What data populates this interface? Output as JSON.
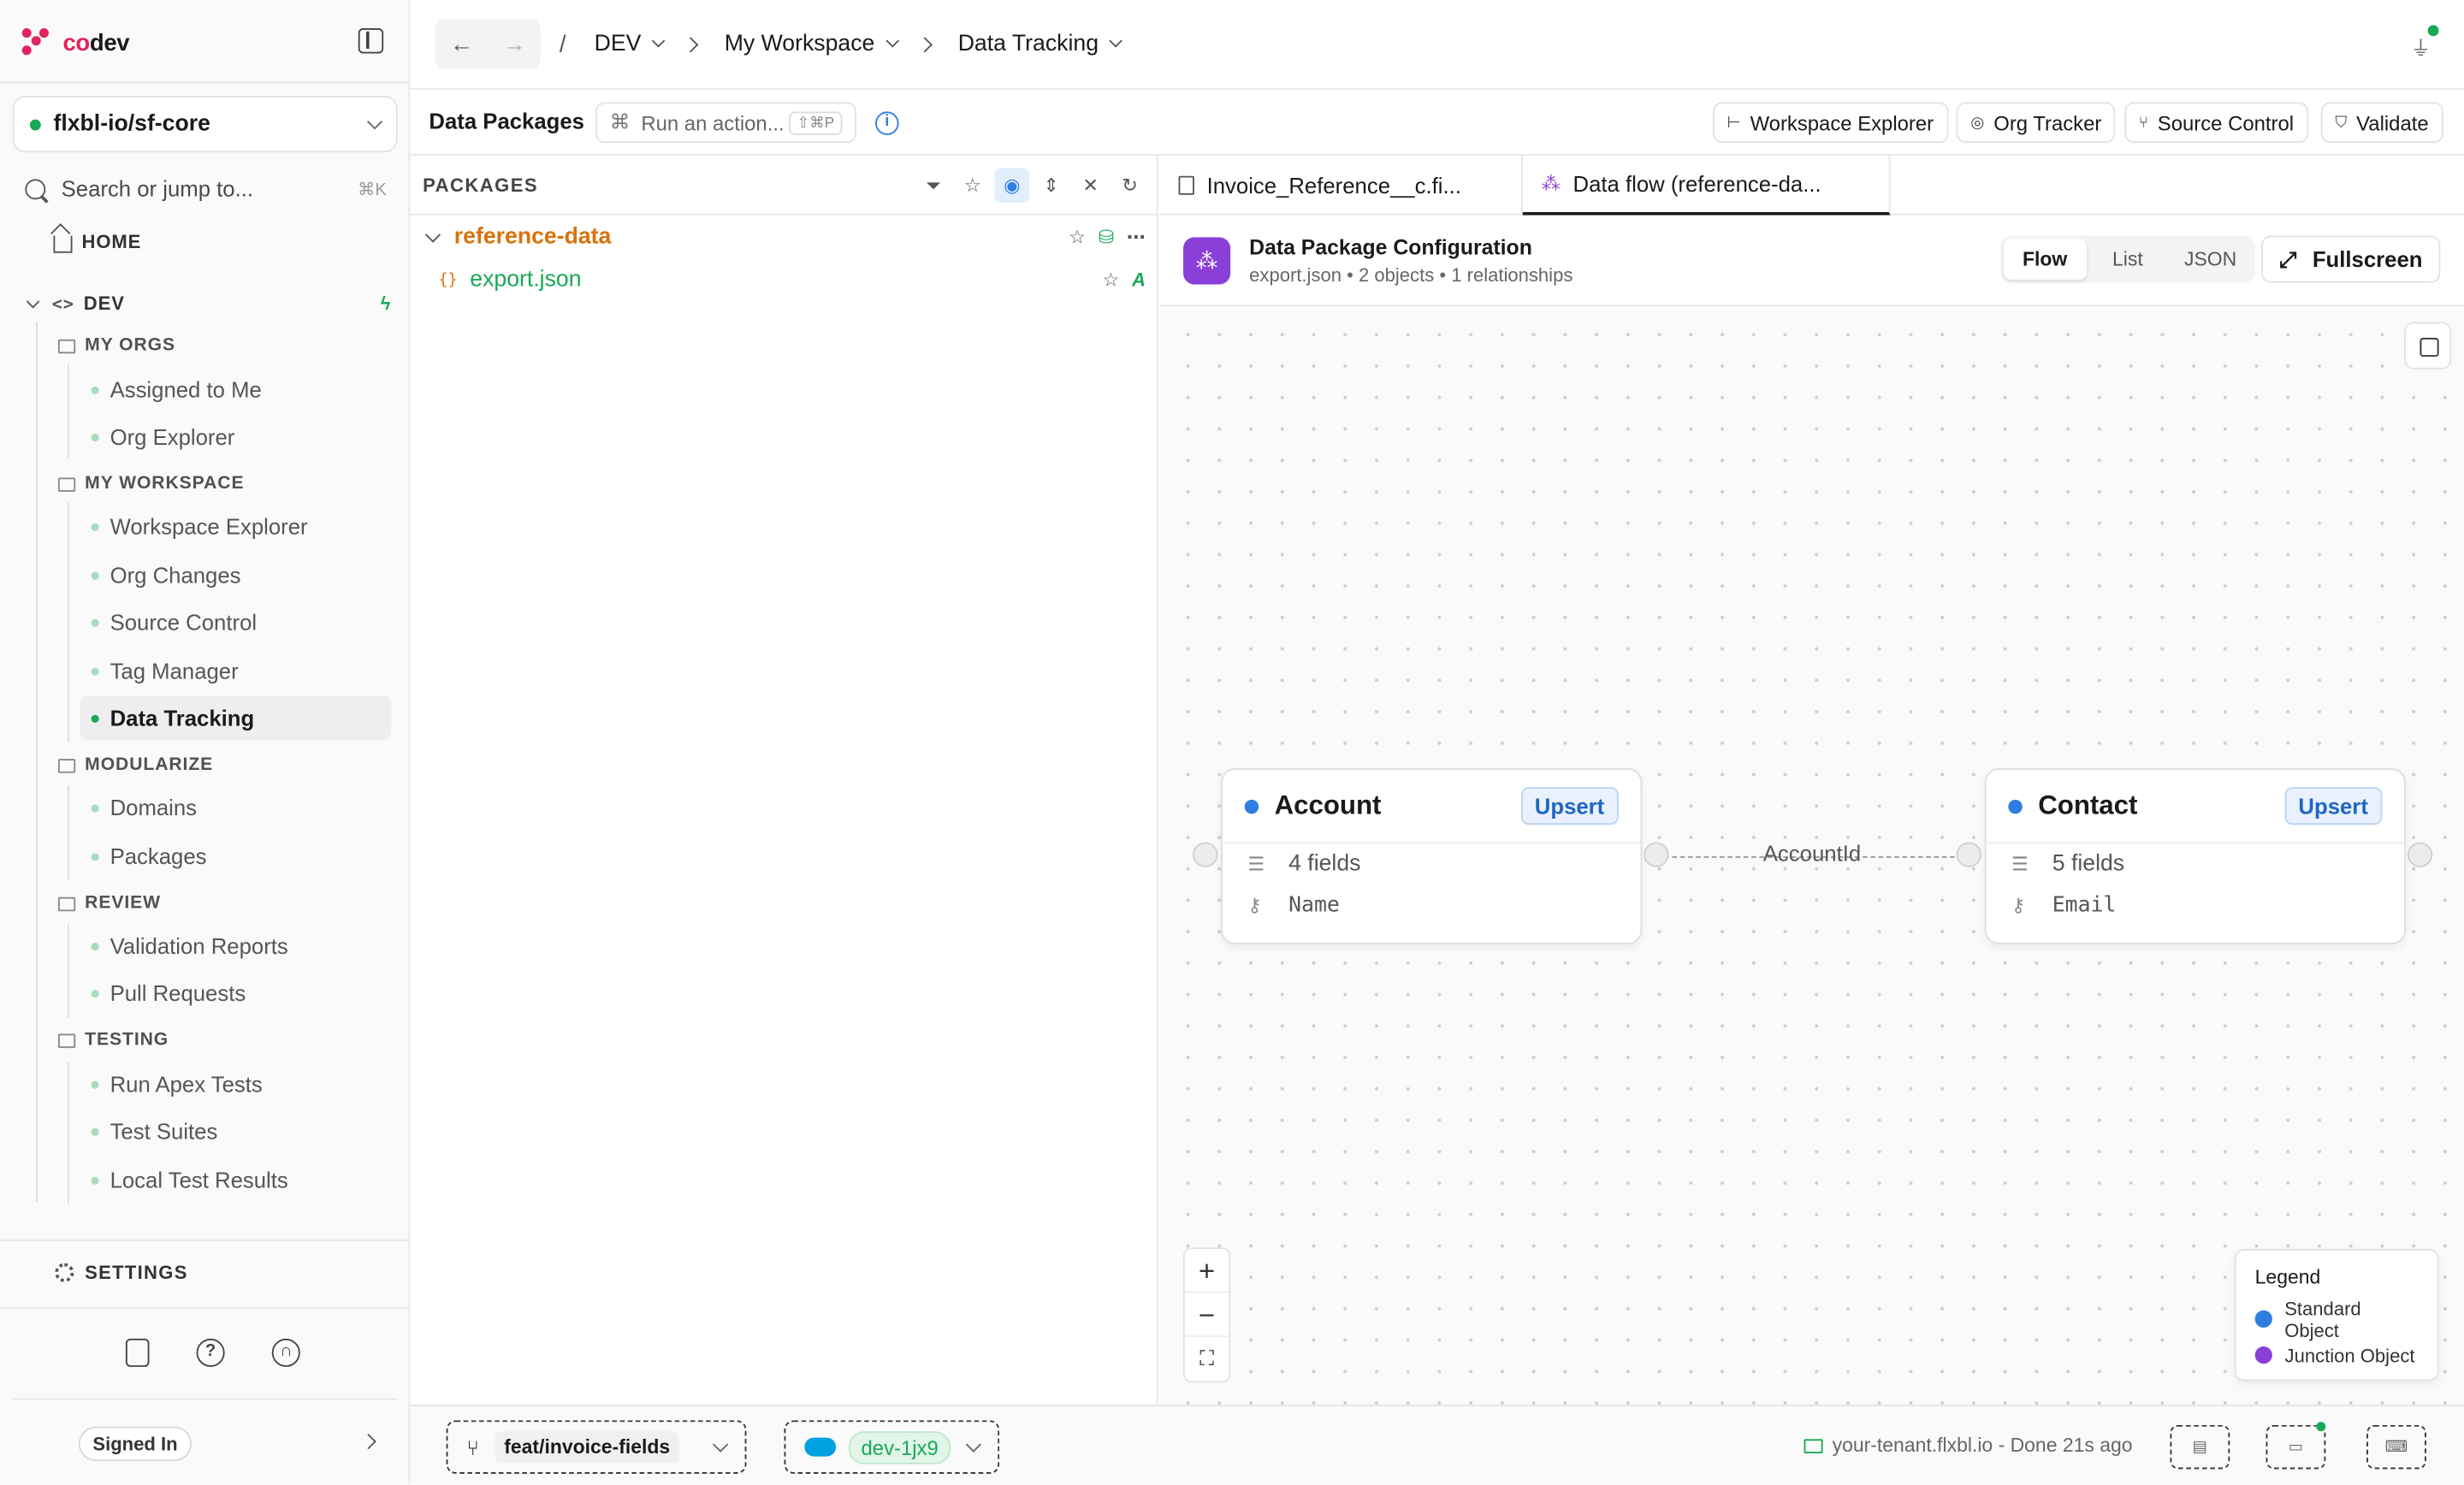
{
  "brand": {
    "prefix": "co",
    "suffix": "dev"
  },
  "sidebar": {
    "org": "flxbl-io/sf-core",
    "search_placeholder": "Search or jump to...",
    "search_shortcut": "⌘K",
    "home": "HOME",
    "dev": "DEV",
    "groups": {
      "my_orgs": "MY ORGS",
      "my_workspace": "MY WORKSPACE",
      "modularize": "MODULARIZE",
      "review": "REVIEW",
      "testing": "TESTING"
    },
    "items": {
      "assigned": "Assigned to Me",
      "org_explorer": "Org Explorer",
      "workspace_explorer": "Workspace Explorer",
      "org_changes": "Org Changes",
      "source_control": "Source Control",
      "tag_manager": "Tag Manager",
      "data_tracking": "Data Tracking",
      "domains": "Domains",
      "packages": "Packages",
      "validation_reports": "Validation Reports",
      "pull_requests": "Pull Requests",
      "run_apex_tests": "Run Apex Tests",
      "test_suites": "Test Suites",
      "local_test_results": "Local Test Results"
    },
    "settings": "SETTINGS",
    "signed_in": "Signed In"
  },
  "topbar": {
    "back": "←",
    "forward": "→",
    "slash": "/",
    "crumbs": [
      "DEV",
      "My Workspace",
      "Data Tracking"
    ]
  },
  "toolbar": {
    "title": "Data Packages",
    "action_placeholder": "Run an action...",
    "action_shortcut": "⇧⌘P",
    "buttons": {
      "workspace_explorer": "Workspace Explorer",
      "org_tracker": "Org Tracker",
      "source_control": "Source Control",
      "validate": "Validate"
    }
  },
  "packages": {
    "title": "PACKAGES",
    "folder": "reference-data",
    "file": "export.json",
    "file_status": "A"
  },
  "editor": {
    "tabs": [
      "Invoice_Reference__c.fi...",
      "Data flow (reference-da..."
    ],
    "config_title": "Data Package Configuration",
    "config_file": "export.json",
    "config_objects": "2 objects",
    "config_relationships": "1 relationships",
    "bullet": "•",
    "views": [
      "Flow",
      "List",
      "JSON"
    ],
    "active_view": "Flow",
    "fullscreen": "Fullscreen"
  },
  "flow": {
    "nodes": [
      {
        "name": "Account",
        "op": "Upsert",
        "fields": "4 fields",
        "key": "Name"
      },
      {
        "name": "Contact",
        "op": "Upsert",
        "fields": "5 fields",
        "key": "Email"
      }
    ],
    "edge_label": "AccountId",
    "zoom_in": "+",
    "zoom_out": "−",
    "fit": "⛶",
    "legend": {
      "title": "Legend",
      "standard": "Standard Object",
      "junction": "Junction Object",
      "standard_color": "#2f7de1",
      "junction_color": "#8b3fd9"
    }
  },
  "footer": {
    "branch": "feat/invoice-fields",
    "org": "dev-1jx9",
    "tenant_status": "your-tenant.flxbl.io - Done 21s ago"
  }
}
